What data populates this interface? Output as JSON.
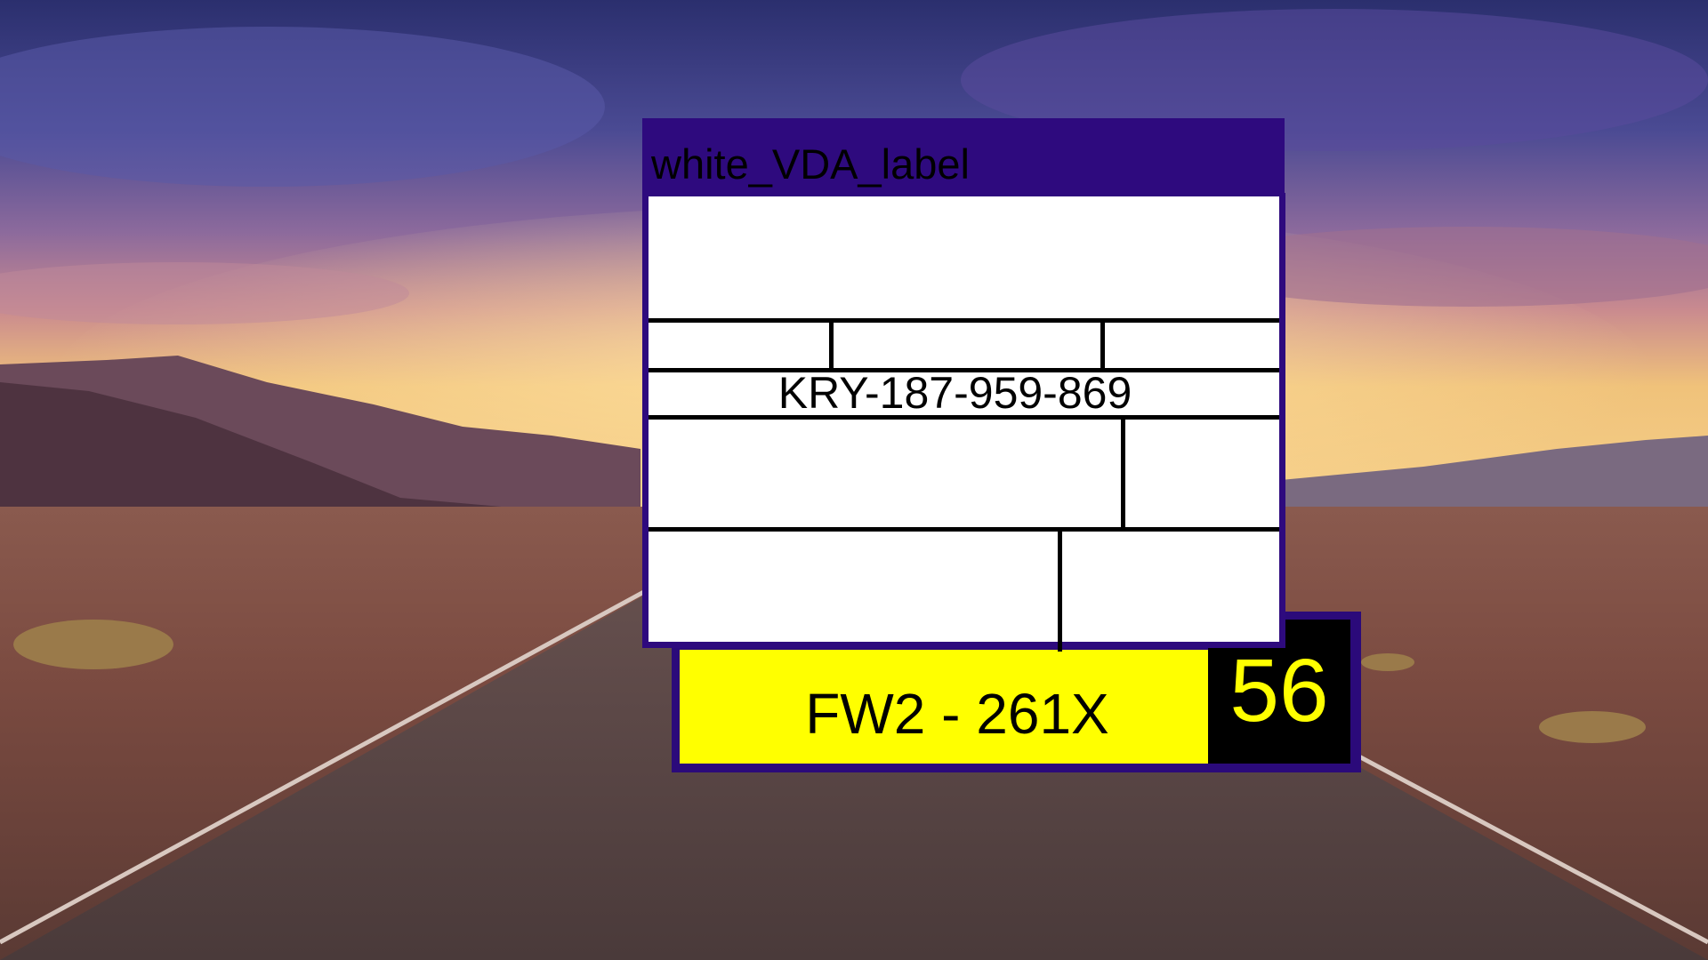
{
  "label": {
    "title": "white_VDA_label",
    "serial_number": "KRY-187-959-869"
  },
  "plate": {
    "text": "FW2 - 261X",
    "number": "56"
  },
  "colors": {
    "titlebar": "#2e0a7e",
    "plate_background": "#ffff00",
    "plate_number": "#ffff00",
    "number_box": "#000000"
  }
}
